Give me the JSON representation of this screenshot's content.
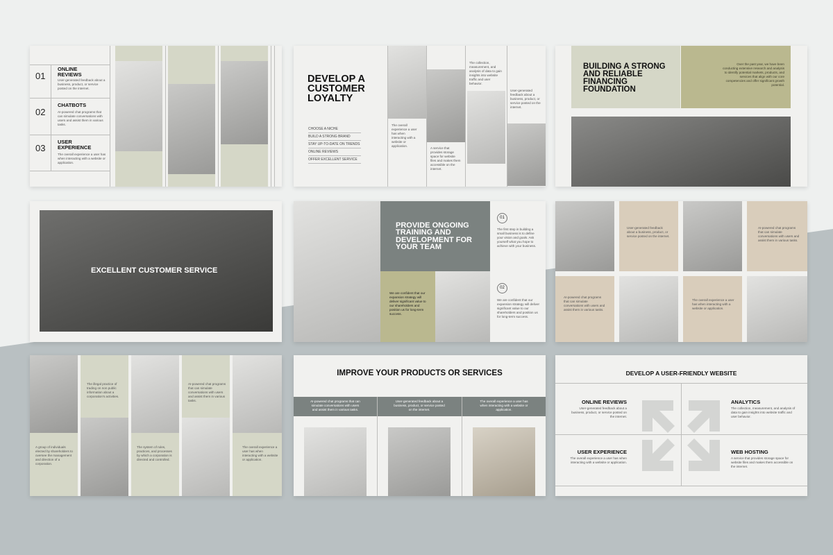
{
  "slide1": {
    "items": [
      {
        "num": "01",
        "title": "ONLINE REVIEWS",
        "desc": "User-generated feedback about a business, product, or service posted on the internet."
      },
      {
        "num": "02",
        "title": "CHATBOTS",
        "desc": "AI-powered chat programs that can simulate conversations with users and assist them in various tasks."
      },
      {
        "num": "03",
        "title": "USER EXPERIENCE",
        "desc": "The overall experience a user has when interacting with a website or application."
      }
    ]
  },
  "slide2": {
    "title": "DEVELOP A CUSTOMER LOYALTY",
    "list": [
      "CHOOSE A NICHE",
      "BUILD A STRONG BRAND",
      "STAY UP-TO-DATE ON TRENDS",
      "ONLINE REVIEWS",
      "OFFER EXCELLENT SERVICE"
    ],
    "text1": "The overall experience a user has when interacting with a website or application.",
    "text2": "A service that provides storage space for website files and makes them accessible on the internet.",
    "text3": "The collection, measurement, and analysis of data to gain insights into website traffic and user behavior.",
    "text4": "User-generated feedback about a business, product, or service posted on the internet."
  },
  "slide3": {
    "title": "BUILDING A STRONG AND RELIABLE FINANCING FOUNDATION",
    "text": "Over the past year, we have been conducting extensive research and analysis to identify potential markets, products, and services that align with our core competencies and offer significant growth potential."
  },
  "slide4": {
    "title": "EXCELLENT CUSTOMER SERVICE"
  },
  "slide5": {
    "title": "PROVIDE ONGOING TRAINING AND DEVELOPMENT FOR YOUR TEAM",
    "olive_text": "We are confident that our expansion strategy will deliver significant value to our shareholders and position us for long-term success.",
    "n1": "01",
    "t1": "The first step in building a small business is to define your vision and goals. Ask yourself what you hope to achieve with your business.",
    "n2": "02",
    "t2": "We are confident that our expansion strategy will deliver significant value to our shareholders and position us for long-term success."
  },
  "slide6": {
    "t1": "User-generated feedback about a business, product, or service posted on the internet.",
    "t2": "AI-powered chat programs that can simulate conversations with users and assist them in various tasks.",
    "t3": "AI-powered chat programs that can simulate conversations with users and assist them in various tasks.",
    "t4": "The overall experience a user has when interacting with a website or application."
  },
  "slide7": {
    "t1": "The illegal practice of trading on non public information about a corporation's activities.",
    "t2": "AI-powered chat programs that can simulate conversations with users and assist them in various tasks.",
    "t3": "A group of individuals elected by shareholders to oversee the management and direction of a corporation.",
    "t4": "The system of rules, practices, and processes by which a corporation is directed and controlled.",
    "t5": "The overall experience a user has when interacting with a website or application."
  },
  "slide8": {
    "title": "IMPROVE YOUR PRODUCTS OR SERVICES",
    "c1": "AI-powered chat programs that can simulate conversations with users and assist them in various tasks.",
    "c2": "User-generated feedback about a business, product, or service posted on the internet.",
    "c3": "The overall experience a user has when interacting with a website or application."
  },
  "slide9": {
    "title": "DEVELOP A USER-FRIENDLY WEBSITE",
    "q1_title": "ONLINE REVIEWS",
    "q1_text": "User-generated feedback about a business, product, or service posted on the internet.",
    "q2_title": "ANALYTICS",
    "q2_text": "The collection, measurement, and analysis of data to gain insights into website traffic and user behavior.",
    "q3_title": "USER EXPERIENCE",
    "q3_text": "The overall experience a user has when interacting with a website or application.",
    "q4_title": "WEB HOSTING",
    "q4_text": "A service that provides storage space for website files and makes them accessible on the internet."
  },
  "colors": {
    "background": "#eef0ef",
    "bottom_band": "#b9c0c2",
    "sage": "#d5d7c7",
    "olive": "#bab88f",
    "tan": "#d9cdbb",
    "slate": "#7b8280"
  }
}
